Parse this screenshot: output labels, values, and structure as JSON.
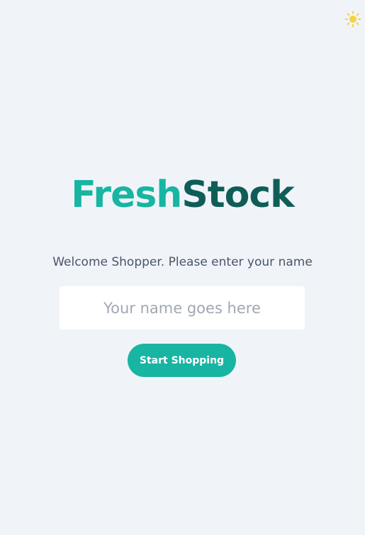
{
  "header": {
    "theme_toggle_icon": "sun-icon",
    "theme_toggle_color": "#f6d33c"
  },
  "brand": {
    "part1": "Fresh",
    "part2": "Stock",
    "color_primary": "#17b5a2",
    "color_secondary": "#0e5e57"
  },
  "welcome": {
    "prompt": "Welcome Shopper. Please enter your name"
  },
  "name_field": {
    "value": "",
    "placeholder": "Your name goes here"
  },
  "actions": {
    "start_label": "Start Shopping",
    "accent": "#17b5a2"
  },
  "background": "#f0f4f9"
}
